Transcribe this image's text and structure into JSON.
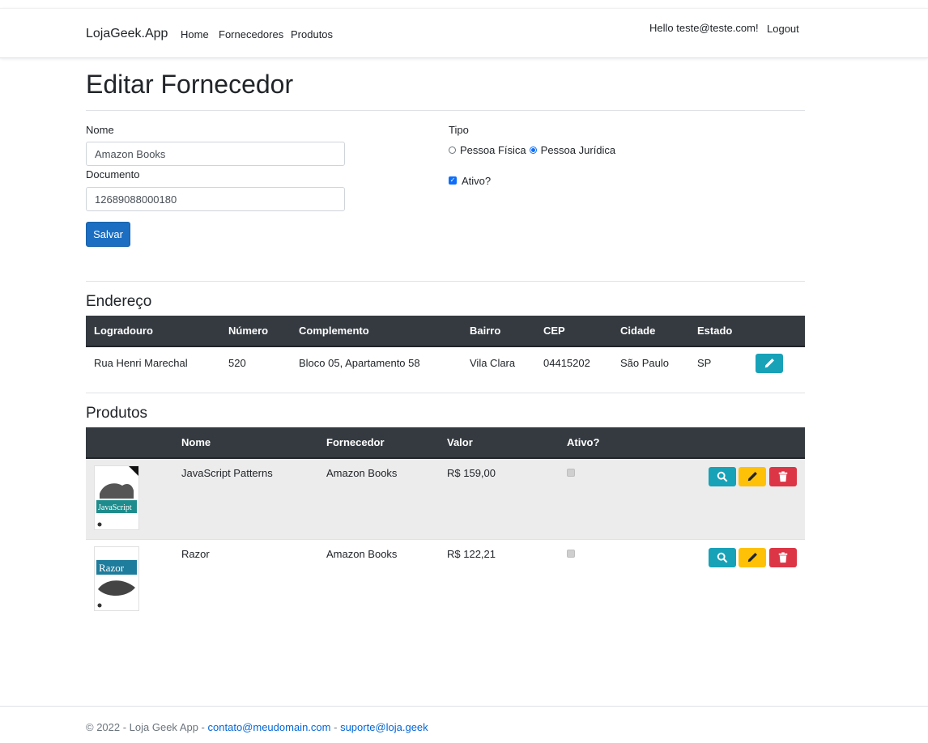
{
  "navbar": {
    "brand": "LojaGeek.App",
    "links": [
      "Home",
      "Fornecedores",
      "Produtos"
    ],
    "hello": "Hello teste@teste.com!",
    "logout": "Logout"
  },
  "page": {
    "title": "Editar Fornecedor"
  },
  "form": {
    "nome_label": "Nome",
    "nome_value": "Amazon Books",
    "documento_label": "Documento",
    "documento_value": "12689088000180",
    "tipo_label": "Tipo",
    "tipo_options": [
      "Pessoa Física",
      "Pessoa Jurídica"
    ],
    "tipo_selected": "Pessoa Jurídica",
    "ativo_label": "Ativo?",
    "ativo_checked": true,
    "save_label": "Salvar"
  },
  "endereco": {
    "title": "Endereço",
    "columns": [
      "Logradouro",
      "Número",
      "Complemento",
      "Bairro",
      "CEP",
      "Cidade",
      "Estado"
    ],
    "row": [
      "Rua Henri Marechal",
      "520",
      "Bloco 05, Apartamento 58",
      "Vila Clara",
      "04415202",
      "São Paulo",
      "SP"
    ],
    "edit_icon": "pencil-icon"
  },
  "produtos": {
    "title": "Produtos",
    "columns": [
      "",
      "Nome",
      "Fornecedor",
      "Valor",
      "Ativo?"
    ],
    "rows": [
      {
        "image_title": "JavaScript",
        "nome": "JavaScript Patterns",
        "fornecedor": "Amazon Books",
        "valor": "R$ 159,00",
        "ativo": true
      },
      {
        "image_title": "Razor",
        "nome": "Razor",
        "fornecedor": "Amazon Books",
        "valor": "R$ 122,21",
        "ativo": true
      }
    ],
    "action_icons": [
      "search-icon",
      "pencil-icon",
      "trash-icon"
    ]
  },
  "footer": {
    "copyright": "© 2022 - Loja Geek App -",
    "email1": "contato@meudomain.com",
    "separator": "-",
    "email2": "suporte@loja.geek"
  },
  "colors": {
    "primary": "#1b6ec2",
    "table_header": "#343a40",
    "info": "#17a2b8",
    "warning": "#ffc107",
    "danger": "#dc3545"
  }
}
